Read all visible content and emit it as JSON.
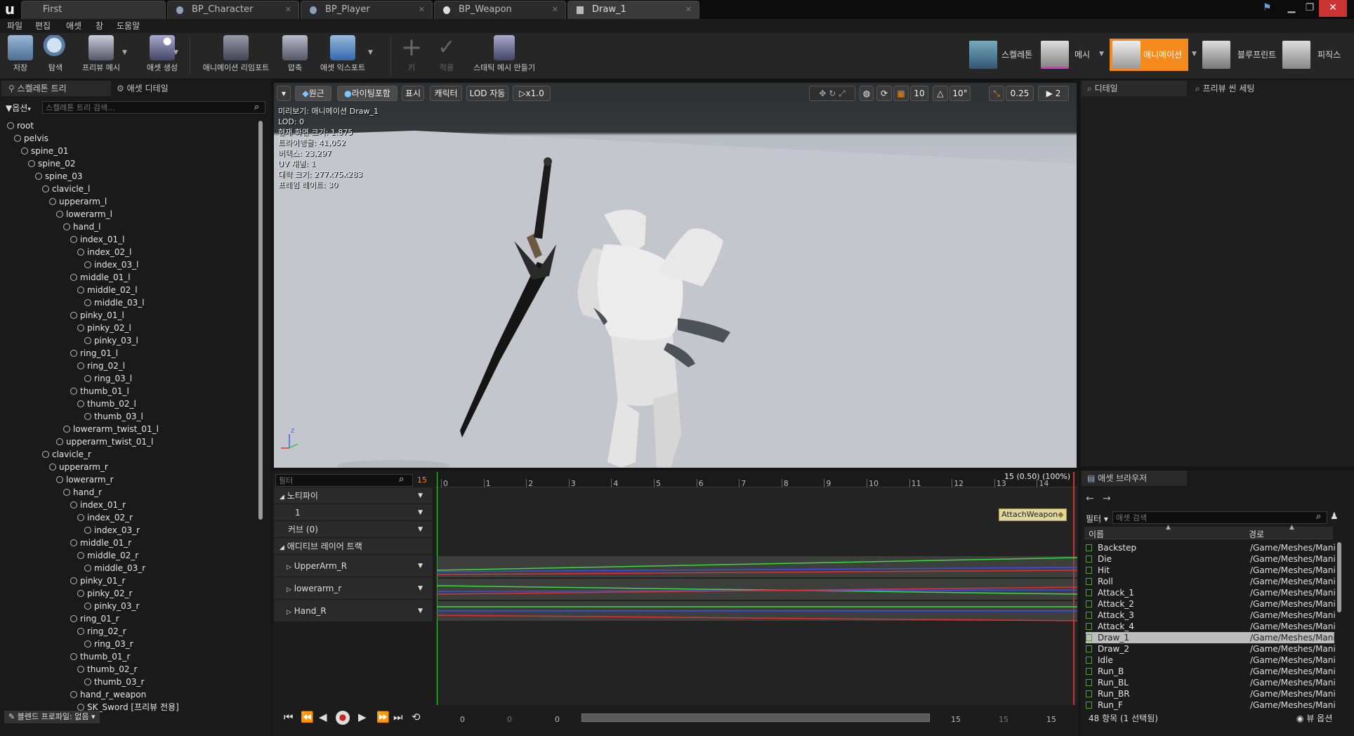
{
  "tabs": [
    {
      "label": "First",
      "active": false
    },
    {
      "label": "BP_Character",
      "active": false
    },
    {
      "label": "BP_Player",
      "active": false
    },
    {
      "label": "BP_Weapon",
      "active": false
    },
    {
      "label": "Draw_1",
      "active": true
    }
  ],
  "menu": [
    "파일",
    "편집",
    "애셋",
    "창",
    "도움말"
  ],
  "toolbar": {
    "save": "저장",
    "browse": "탐색",
    "preview_mesh": "프리뷰 메시",
    "create_asset": "애셋 생성",
    "reimport": "애니메이션 리임포트",
    "compress": "압축",
    "export_asset": "애셋 익스포트",
    "key": "키",
    "apply": "적용",
    "make_static_mesh": "스태틱 메시 만들기"
  },
  "modes": {
    "skeleton": "스켈레톤",
    "mesh": "메시",
    "animation": "애니메이션",
    "blueprint": "블루프린트",
    "physics": "피직스"
  },
  "left_panel": {
    "tab_tree": "스켈레톤 트리",
    "tab_details": "애셋 디테일",
    "options": "옵션",
    "search_placeholder": "스켈레톤 트리 검색...",
    "blend_profile": "블렌드 프로파일: 없음"
  },
  "tree": [
    "root",
    "pelvis",
    "spine_01",
    "spine_02",
    "spine_03",
    "clavicle_l",
    "upperarm_l",
    "lowerarm_l",
    "hand_l",
    "index_01_l",
    "index_02_l",
    "index_03_l",
    "middle_01_l",
    "middle_02_l",
    "middle_03_l",
    "pinky_01_l",
    "pinky_02_l",
    "pinky_03_l",
    "ring_01_l",
    "ring_02_l",
    "ring_03_l",
    "thumb_01_l",
    "thumb_02_l",
    "thumb_03_l",
    "lowerarm_twist_01_l",
    "upperarm_twist_01_l",
    "clavicle_r",
    "upperarm_r",
    "lowerarm_r",
    "hand_r",
    "index_01_r",
    "index_02_r",
    "index_03_r",
    "middle_01_r",
    "middle_02_r",
    "middle_03_r",
    "pinky_01_r",
    "pinky_02_r",
    "pinky_03_r",
    "ring_01_r",
    "ring_02_r",
    "ring_03_r",
    "thumb_01_r",
    "thumb_02_r",
    "thumb_03_r",
    "hand_r_weapon",
    "SK_Sword [프리뷰 전용]"
  ],
  "viewport": {
    "buttons": {
      "perspective": "원근",
      "lit": "라이팅포함",
      "show": "표시",
      "character": "캐릭터",
      "lod": "LOD 자동",
      "speed": "x1.0"
    },
    "snap": {
      "grid": "10",
      "rot": "10°",
      "scale": "0.25",
      "cam": "2"
    },
    "info": [
      "미리보기: 애니메이션 Draw_1",
      "LOD: 0",
      "현재 화면 크기: 1.875",
      "트라이앵글: 41,052",
      "버텍스: 23,297",
      "UV 채널: 1",
      "대략 크기: 277x75x283",
      "프레임 레이트: 30"
    ]
  },
  "right_panel": {
    "tab_details": "디테일",
    "tab_preview": "프리뷰 씬 세팅"
  },
  "timeline": {
    "filter_placeholder": "필터",
    "frame": "15",
    "frame_readout": "15 (0.50) (100%)",
    "ticks": [
      "0",
      "1",
      "2",
      "3",
      "4",
      "5",
      "6",
      "7",
      "8",
      "9",
      "10",
      "11",
      "12",
      "13",
      "14"
    ],
    "notifies": "노티파이",
    "notify_track": "1",
    "curves": "커브  (0)",
    "additive": "애디티브 레이어 트랙",
    "tracks": [
      "UpperArm_R",
      "lowerarm_r",
      "Hand_R"
    ],
    "notify_label": "AttachWeapon",
    "start_vals": [
      "0",
      "0",
      "0"
    ],
    "end_vals": [
      "15",
      "15",
      "15"
    ]
  },
  "asset_browser": {
    "tab": "애셋 브라우저",
    "filter": "필터",
    "search_placeholder": "애셋 검색",
    "col_name": "이름",
    "col_path": "경로",
    "items": [
      {
        "name": "Backstep",
        "path": "/Game/Meshes/Mani"
      },
      {
        "name": "Die",
        "path": "/Game/Meshes/Mani"
      },
      {
        "name": "Hit",
        "path": "/Game/Meshes/Mani"
      },
      {
        "name": "Roll",
        "path": "/Game/Meshes/Mani"
      },
      {
        "name": "Attack_1",
        "path": "/Game/Meshes/Mani"
      },
      {
        "name": "Attack_2",
        "path": "/Game/Meshes/Mani"
      },
      {
        "name": "Attack_3",
        "path": "/Game/Meshes/Mani"
      },
      {
        "name": "Attack_4",
        "path": "/Game/Meshes/Mani"
      },
      {
        "name": "Draw_1",
        "path": "/Game/Meshes/Mani"
      },
      {
        "name": "Draw_2",
        "path": "/Game/Meshes/Mani"
      },
      {
        "name": "Idle",
        "path": "/Game/Meshes/Mani"
      },
      {
        "name": "Run_B",
        "path": "/Game/Meshes/Mani"
      },
      {
        "name": "Run_BL",
        "path": "/Game/Meshes/Mani"
      },
      {
        "name": "Run_BR",
        "path": "/Game/Meshes/Mani"
      },
      {
        "name": "Run_F",
        "path": "/Game/Meshes/Mani"
      }
    ],
    "selected_index": 8,
    "count": "48 항목 (1 선택됨)",
    "view_options": "뷰 옵션"
  }
}
